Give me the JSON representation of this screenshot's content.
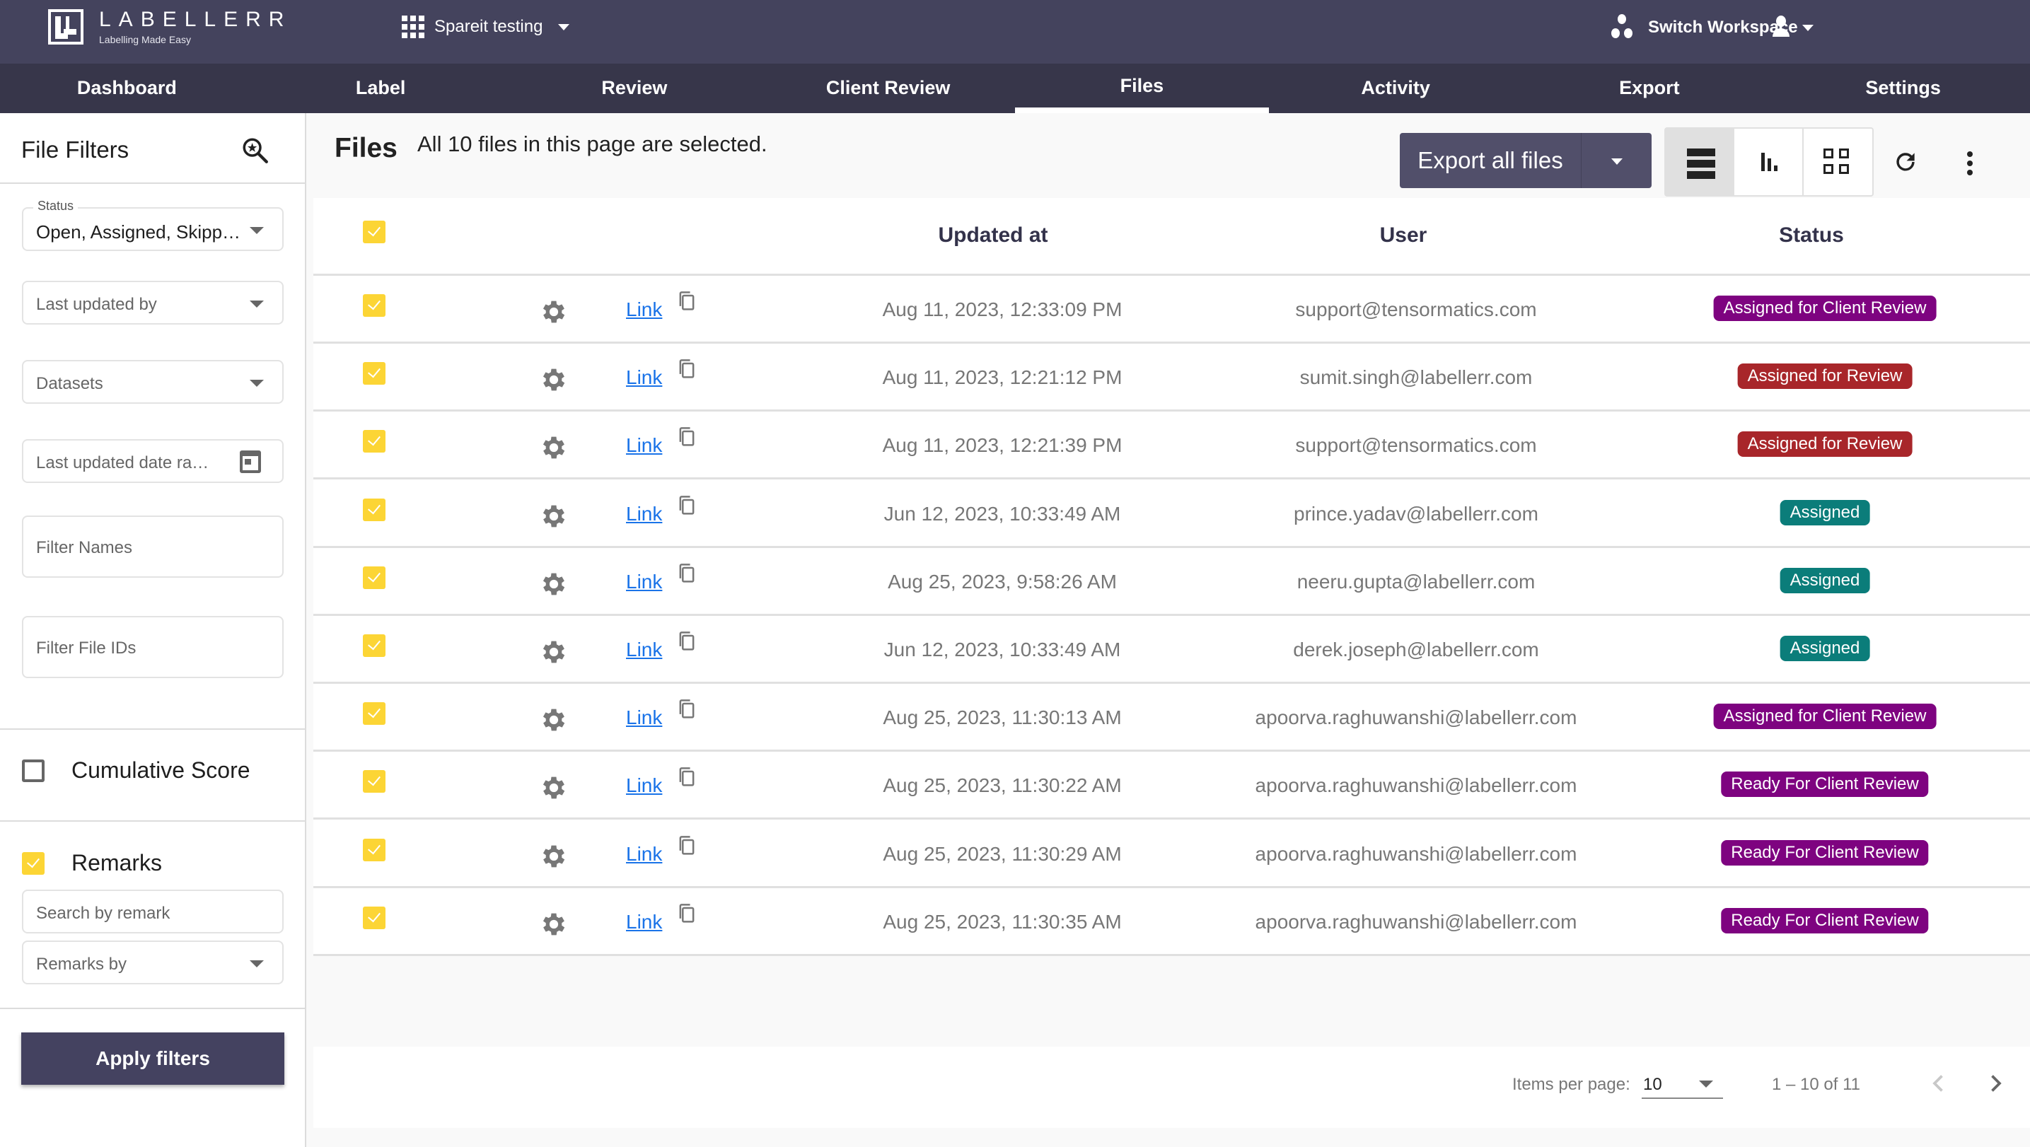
{
  "app": {
    "logo_title": "LABELLERR",
    "logo_tagline": "Labelling Made Easy",
    "workspace_name": "Spareit testing",
    "switch_workspace_label": "Switch Workspace"
  },
  "nav": {
    "tabs": [
      {
        "label": "Dashboard",
        "active": false
      },
      {
        "label": "Label",
        "active": false
      },
      {
        "label": "Review",
        "active": false
      },
      {
        "label": "Client Review",
        "active": false
      },
      {
        "label": "Files",
        "active": true
      },
      {
        "label": "Activity",
        "active": false
      },
      {
        "label": "Export",
        "active": false
      },
      {
        "label": "Settings",
        "active": false
      }
    ]
  },
  "sidebar": {
    "title": "File Filters",
    "status_legend": "Status",
    "status_value": "Open, Assigned, Skipp…",
    "last_updated_by_placeholder": "Last updated by",
    "datasets_placeholder": "Datasets",
    "date_range_placeholder": "Last updated date ra…",
    "filter_names_placeholder": "Filter Names",
    "filter_file_ids_placeholder": "Filter File IDs",
    "cumulative_score_label": "Cumulative Score",
    "cumulative_score_checked": false,
    "remarks_label": "Remarks",
    "remarks_checked": true,
    "search_remark_placeholder": "Search by remark",
    "remarks_by_placeholder": "Remarks by",
    "apply_label": "Apply filters"
  },
  "main": {
    "title": "Files",
    "selection_message": "All 10 files in this page are selected.",
    "export_label": "Export all files",
    "view_modes": [
      "list-view",
      "chart-view",
      "grid-view"
    ],
    "active_view": "list-view"
  },
  "table": {
    "columns": [
      "",
      "",
      "",
      "Updated at",
      "User",
      "Status"
    ],
    "link_label": "Link",
    "status_colors": {
      "Assigned for Client Review": "#7e0380",
      "Assigned for Review": "#a8262a",
      "Assigned": "#0b7d7a",
      "Ready For Client Review": "#7e0380"
    },
    "rows": [
      {
        "updated_at": "Aug 11, 2023, 12:33:09 PM",
        "user": "support@tensormatics.com",
        "status": "Assigned for Client Review"
      },
      {
        "updated_at": "Aug 11, 2023, 12:21:12 PM",
        "user": "sumit.singh@labellerr.com",
        "status": "Assigned for Review"
      },
      {
        "updated_at": "Aug 11, 2023, 12:21:39 PM",
        "user": "support@tensormatics.com",
        "status": "Assigned for Review"
      },
      {
        "updated_at": "Jun 12, 2023, 10:33:49 AM",
        "user": "prince.yadav@labellerr.com",
        "status": "Assigned"
      },
      {
        "updated_at": "Aug 25, 2023, 9:58:26 AM",
        "user": "neeru.gupta@labellerr.com",
        "status": "Assigned"
      },
      {
        "updated_at": "Jun 12, 2023, 10:33:49 AM",
        "user": "derek.joseph@labellerr.com",
        "status": "Assigned"
      },
      {
        "updated_at": "Aug 25, 2023, 11:30:13 AM",
        "user": "apoorva.raghuwanshi@labellerr.com",
        "status": "Assigned for Client Review"
      },
      {
        "updated_at": "Aug 25, 2023, 11:30:22 AM",
        "user": "apoorva.raghuwanshi@labellerr.com",
        "status": "Ready For Client Review"
      },
      {
        "updated_at": "Aug 25, 2023, 11:30:29 AM",
        "user": "apoorva.raghuwanshi@labellerr.com",
        "status": "Ready For Client Review"
      },
      {
        "updated_at": "Aug 25, 2023, 11:30:35 AM",
        "user": "apoorva.raghuwanshi@labellerr.com",
        "status": "Ready For Client Review"
      }
    ]
  },
  "pagination": {
    "items_per_page_label": "Items per page:",
    "items_per_page": "10",
    "range_label": "1 – 10 of 11"
  }
}
